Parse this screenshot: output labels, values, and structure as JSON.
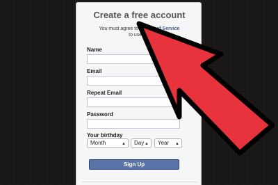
{
  "form": {
    "title": "Create a free account",
    "terms_line1_prefix": "You must agree to t",
    "terms_link": "of Service",
    "terms_line2": "to use the",
    "fields": [
      {
        "label": "Name",
        "value": ""
      },
      {
        "label": "Email",
        "value": ""
      },
      {
        "label": "Repeat Email",
        "value": ""
      },
      {
        "label": "Password",
        "value": ""
      }
    ],
    "birthday_label": "Your birthday",
    "month": "Month",
    "day": "Day",
    "year": "Year",
    "submit_label": "Sign Up"
  },
  "overlay": {
    "arrow_color": "#e8323c",
    "arrow_outline": "#000000"
  }
}
